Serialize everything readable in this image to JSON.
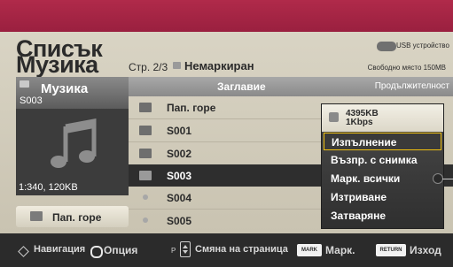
{
  "header": {
    "title_line1": "Списък",
    "title_line2": "Музика",
    "page_info": "Стр. 2/3",
    "filter_label": "Немаркиран",
    "device_label": "USB устройство",
    "free_space": "Свободно място 150MB"
  },
  "album": {
    "title": "Музика",
    "subtitle": "S003",
    "info": "1:340, 120KB",
    "up_folder_label": "Пап. горе"
  },
  "list": {
    "columns": {
      "title": "Заглавие",
      "duration": "Продължителност"
    },
    "rows": [
      {
        "label": "Пап. горе",
        "kind": "up-folder"
      },
      {
        "label": "S001",
        "kind": "folder"
      },
      {
        "label": "S002",
        "kind": "folder"
      },
      {
        "label": "S003",
        "kind": "folder"
      },
      {
        "label": "S004",
        "kind": "music"
      },
      {
        "label": "S005",
        "kind": "music"
      }
    ]
  },
  "popup": {
    "size_line1": "4395KB",
    "size_line2": "1Kbps",
    "items": [
      "Изпълнение",
      "Възпр. с снимка",
      "Марк. всички",
      "Изтриване",
      "Затваряне"
    ]
  },
  "footer": {
    "navigation": "Навигация",
    "option": "Опция",
    "page_key": "P",
    "page_change": "Смяна на страница",
    "mark_key": "MARK",
    "mark_label": "Марк.",
    "return_key": "RETURN",
    "exit_label": "Изход"
  },
  "colors": {
    "top_band": "#a8294a",
    "panel": "#d2cdbd",
    "selected_row": "#2e2e2e",
    "popup_highlight_border": "#f0c010"
  }
}
